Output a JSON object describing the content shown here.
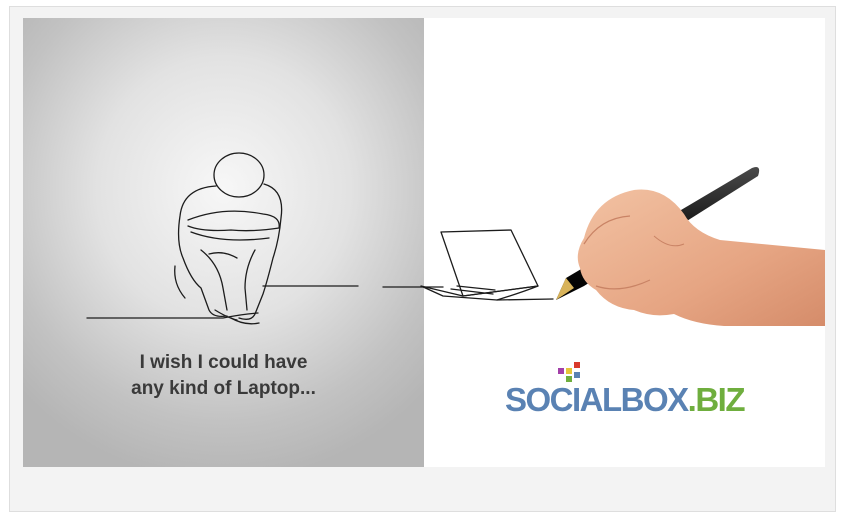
{
  "caption": {
    "line1": "I wish I could have",
    "line2": "any kind of Laptop..."
  },
  "logo": {
    "name": "SOCIALBOX",
    "tld": ".BIZ"
  },
  "colors": {
    "caption": "#3a3a3a",
    "logo_main": "#5a82b3",
    "logo_tld": "#6fae3e",
    "dot_purple": "#a23fa8",
    "dot_red": "#d93a2b",
    "dot_yellow": "#e7c53a",
    "dot_green": "#6fae3e",
    "dot_blue": "#5a82b3"
  }
}
